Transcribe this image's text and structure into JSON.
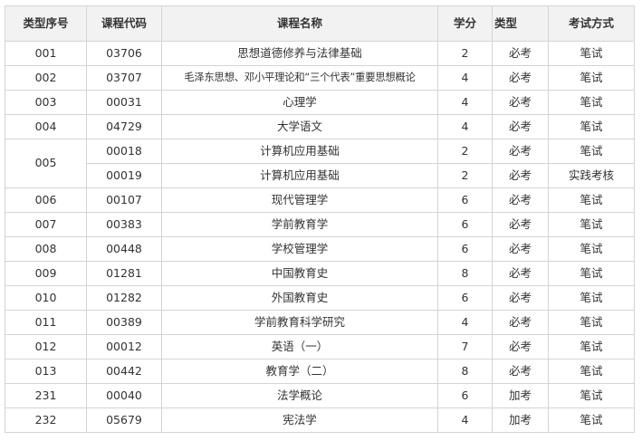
{
  "table": {
    "headers": [
      "类型序号",
      "课程代码",
      "课程名称",
      "学分",
      "类型",
      "考试方式"
    ],
    "rows": [
      {
        "seq": "001",
        "code": "03706",
        "name": "思想道德修养与法律基础",
        "credit": "2",
        "kind": "必考",
        "exam": "笔试"
      },
      {
        "seq": "002",
        "code": "03707",
        "name": "毛泽东思想、邓小平理论和“三个代表”重要思想概论",
        "credit": "4",
        "kind": "必考",
        "exam": "笔试"
      },
      {
        "seq": "003",
        "code": "00031",
        "name": "心理学",
        "credit": "4",
        "kind": "必考",
        "exam": "笔试"
      },
      {
        "seq": "004",
        "code": "04729",
        "name": "大学语文",
        "credit": "4",
        "kind": "必考",
        "exam": "笔试"
      },
      {
        "seq": "005",
        "code": "00018",
        "name": "计算机应用基础",
        "credit": "2",
        "kind": "必考",
        "exam": "笔试"
      },
      {
        "seq": "",
        "code": "00019",
        "name": "计算机应用基础",
        "credit": "2",
        "kind": "必考",
        "exam": "实践考核"
      },
      {
        "seq": "006",
        "code": "00107",
        "name": "现代管理学",
        "credit": "6",
        "kind": "必考",
        "exam": "笔试"
      },
      {
        "seq": "007",
        "code": "00383",
        "name": "学前教育学",
        "credit": "6",
        "kind": "必考",
        "exam": "笔试"
      },
      {
        "seq": "008",
        "code": "00448",
        "name": "学校管理学",
        "credit": "6",
        "kind": "必考",
        "exam": "笔试"
      },
      {
        "seq": "009",
        "code": "01281",
        "name": "中国教育史",
        "credit": "8",
        "kind": "必考",
        "exam": "笔试"
      },
      {
        "seq": "010",
        "code": "01282",
        "name": "外国教育史",
        "credit": "6",
        "kind": "必考",
        "exam": "笔试"
      },
      {
        "seq": "011",
        "code": "00389",
        "name": "学前教育科学研究",
        "credit": "4",
        "kind": "必考",
        "exam": "笔试"
      },
      {
        "seq": "012",
        "code": "00012",
        "name": "英语（一）",
        "credit": "7",
        "kind": "必考",
        "exam": "笔试"
      },
      {
        "seq": "013",
        "code": "00442",
        "name": "教育学（二）",
        "credit": "8",
        "kind": "必考",
        "exam": "笔试"
      },
      {
        "seq": "231",
        "code": "00040",
        "name": "法学概论",
        "credit": "6",
        "kind": "加考",
        "exam": "笔试"
      },
      {
        "seq": "232",
        "code": "05679",
        "name": "宪法学",
        "credit": "4",
        "kind": "加考",
        "exam": "笔试"
      }
    ]
  }
}
